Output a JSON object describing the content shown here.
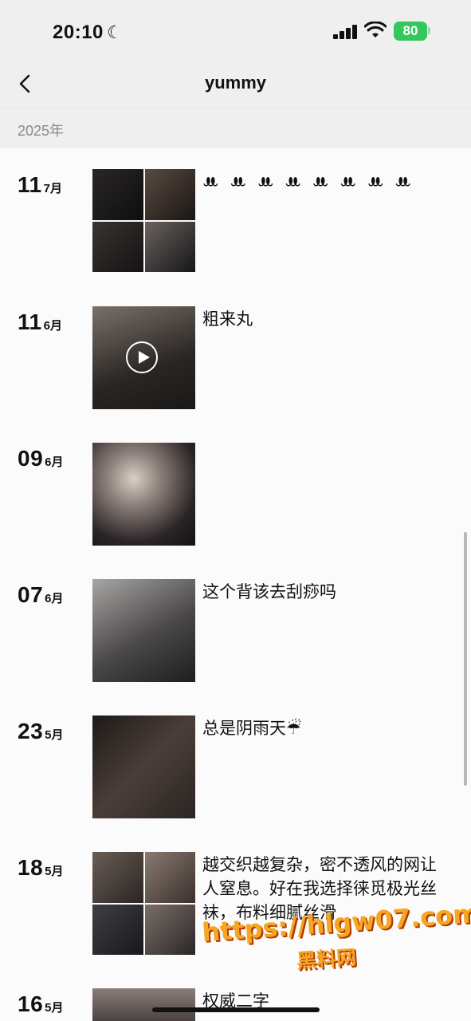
{
  "status": {
    "time": "20:10",
    "battery": "80"
  },
  "nav": {
    "title": "yummy"
  },
  "section": {
    "year": "2025年"
  },
  "entries": [
    {
      "day": "11",
      "month": "7月",
      "text": "ꔚ ꔚ ꔚ ꔚ ꔚ ꔚ ꔚ ꔚ",
      "media": "grid",
      "tones": [
        "#1d1b1c",
        "#3a2e2a",
        "#272222",
        "#151515"
      ]
    },
    {
      "day": "11",
      "month": "6月",
      "text": "粗来丸",
      "media": "video",
      "tones": [
        "#4a4440"
      ]
    },
    {
      "day": "09",
      "month": "6月",
      "text": "",
      "media": "single",
      "tones": [
        "#2f2a2b"
      ]
    },
    {
      "day": "07",
      "month": "6月",
      "text": "这个背该去刮痧吗",
      "media": "single",
      "tones": [
        "#6b6e72"
      ]
    },
    {
      "day": "23",
      "month": "5月",
      "text": "总是阴雨天☔",
      "media": "single",
      "tones": [
        "#2a2422"
      ]
    },
    {
      "day": "18",
      "month": "5月",
      "text": "越交织越复杂，密不透风的网让人窒息。好在我选择徕觅极光丝袜，布料细腻丝滑",
      "media": "grid",
      "tones": [
        "#3b3530",
        "#5a4f4a",
        "#2f2f33",
        "#4a4542"
      ]
    },
    {
      "day": "16",
      "month": "5月",
      "text": "权威二字",
      "media": "single",
      "tones": [
        "#6a605b"
      ]
    }
  ],
  "watermark": {
    "url": "https://hlgw07.com",
    "name": "黑料网"
  },
  "colors": {
    "battery": "#34c759",
    "header_bg": "#efefef",
    "page_bg": "#fbfbfb",
    "watermark": "#f5a623"
  }
}
